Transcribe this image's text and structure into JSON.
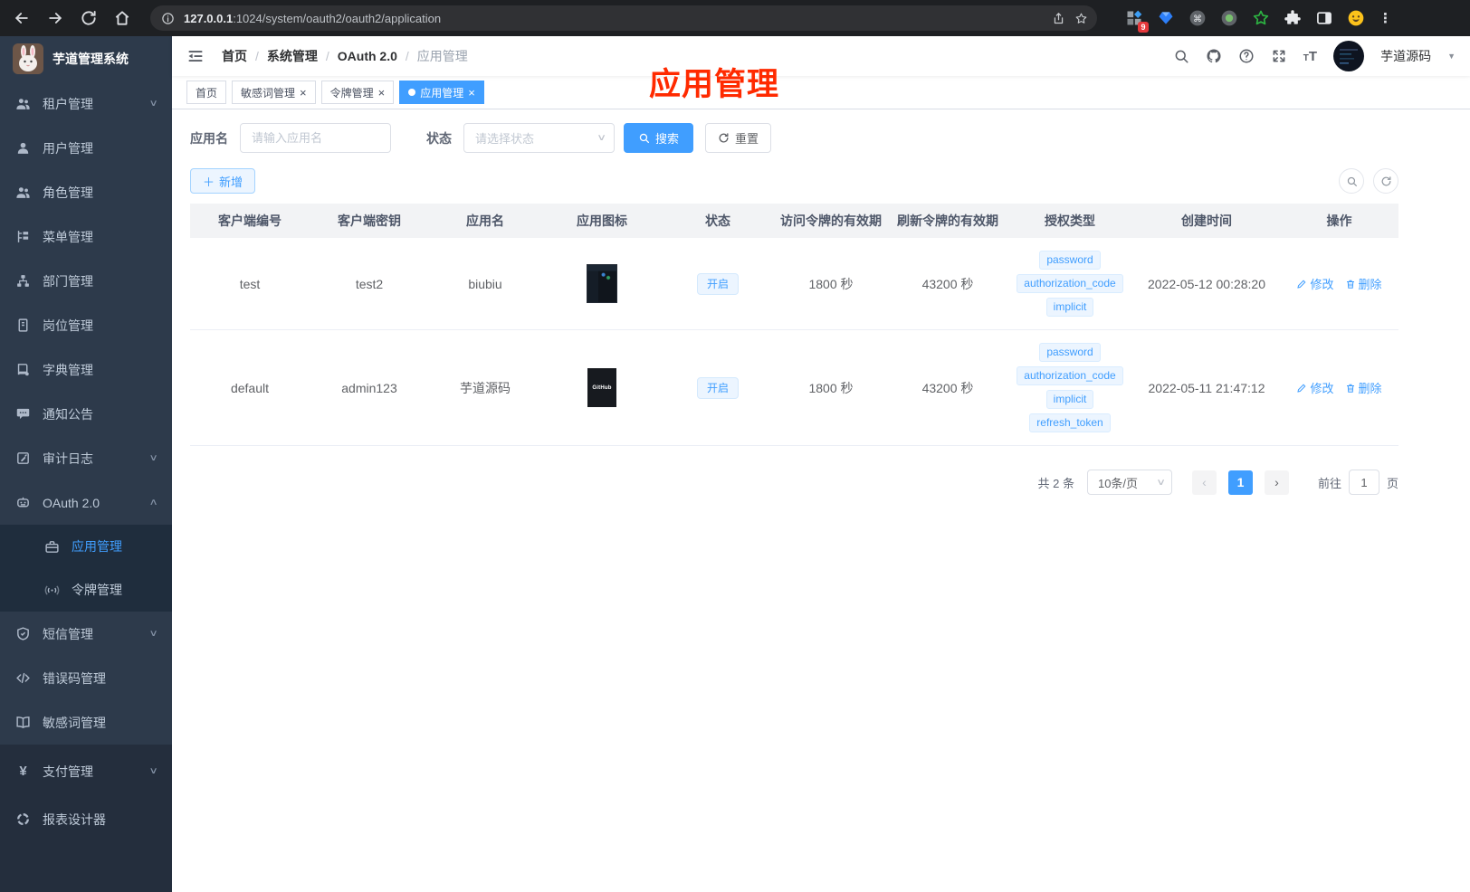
{
  "browser": {
    "url_host": "127.0.0.1",
    "url_rest": ":1024/system/oauth2/oauth2/application",
    "extension_badge": "9"
  },
  "sidebar": {
    "logo_title": "芋道管理系统",
    "items": [
      {
        "id": "tenant",
        "icon": "users",
        "label": "租户管理",
        "chevron": "down"
      },
      {
        "id": "user",
        "icon": "user",
        "label": "用户管理"
      },
      {
        "id": "role",
        "icon": "users",
        "label": "角色管理"
      },
      {
        "id": "menu",
        "icon": "menu-tree",
        "label": "菜单管理"
      },
      {
        "id": "dept",
        "icon": "org-tree",
        "label": "部门管理"
      },
      {
        "id": "post",
        "icon": "badge",
        "label": "岗位管理"
      },
      {
        "id": "dict",
        "icon": "dict-book",
        "label": "字典管理"
      },
      {
        "id": "notice",
        "icon": "chat",
        "label": "通知公告"
      },
      {
        "id": "audit",
        "icon": "edit-note",
        "label": "审计日志",
        "chevron": "down"
      },
      {
        "id": "oauth",
        "icon": "robot",
        "label": "OAuth 2.0",
        "chevron": "up"
      },
      {
        "id": "oauth-app",
        "icon": "briefcase",
        "label": "应用管理",
        "sub": true,
        "active": true
      },
      {
        "id": "oauth-token",
        "icon": "signal",
        "label": "令牌管理",
        "sub": true
      },
      {
        "id": "sms",
        "icon": "shield",
        "label": "短信管理",
        "chevron": "down"
      },
      {
        "id": "errcode",
        "icon": "code",
        "label": "错误码管理"
      },
      {
        "id": "sensitive",
        "icon": "open-book",
        "label": "敏感词管理"
      },
      {
        "id": "pay",
        "icon": "yen",
        "label": "支付管理",
        "chevron": "down",
        "group": "bottom"
      },
      {
        "id": "report",
        "icon": "report",
        "label": "报表设计器",
        "group": "bottom"
      }
    ]
  },
  "header": {
    "breadcrumb": [
      "首页",
      "系统管理",
      "OAuth 2.0",
      "应用管理"
    ],
    "user_name": "芋道源码"
  },
  "tabs": [
    {
      "label": "首页",
      "closable": false,
      "active": false
    },
    {
      "label": "敏感词管理",
      "closable": true,
      "active": false
    },
    {
      "label": "令牌管理",
      "closable": true,
      "active": false
    },
    {
      "label": "应用管理",
      "closable": true,
      "active": true
    }
  ],
  "annotation": {
    "text": "应用管理",
    "color": "#ff2a00"
  },
  "filters": {
    "name_label": "应用名",
    "name_placeholder": "请输入应用名",
    "status_label": "状态",
    "status_placeholder": "请选择状态",
    "search_label": "搜索",
    "reset_label": "重置"
  },
  "toolbar": {
    "add_label": "新增"
  },
  "table": {
    "headers": [
      "客户端编号",
      "客户端密钥",
      "应用名",
      "应用图标",
      "状态",
      "访问令牌的有效期",
      "刷新令牌的有效期",
      "授权类型",
      "创建时间",
      "操作"
    ],
    "actions": {
      "edit": "修改",
      "delete": "删除"
    },
    "rows": [
      {
        "client_id": "test",
        "secret": "test2",
        "name": "biubiu",
        "icon_type": "screenshot",
        "icon_label": "",
        "status": "开启",
        "access_token_ttl": "1800 秒",
        "refresh_token_ttl": "43200 秒",
        "grant_types": [
          "password",
          "authorization_code",
          "implicit"
        ],
        "created_at": "2022-05-12 00:28:20"
      },
      {
        "client_id": "default",
        "secret": "admin123",
        "name": "芋道源码",
        "icon_type": "github",
        "icon_label": "GitHub",
        "status": "开启",
        "access_token_ttl": "1800 秒",
        "refresh_token_ttl": "43200 秒",
        "grant_types": [
          "password",
          "authorization_code",
          "implicit",
          "refresh_token"
        ],
        "created_at": "2022-05-11 21:47:12"
      }
    ]
  },
  "pagination": {
    "total_text": "共 2 条",
    "page_size": "10条/页",
    "current_page": "1",
    "goto_label": "前往",
    "goto_value": "1",
    "page_unit": "页"
  },
  "colors": {
    "accent": "#409eff",
    "sidebar_bg": "#2d3a4b",
    "submenu_bg": "#1f2d3d",
    "tag_bg": "#ecf5ff",
    "annotation_red": "#ff2a00"
  }
}
